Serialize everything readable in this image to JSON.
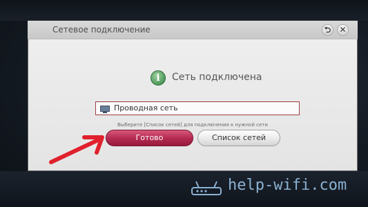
{
  "dialog": {
    "title": "Сетевое подключение",
    "back_icon": "back-arrow-icon",
    "close_icon": "close-icon",
    "back_glyph": "⮌",
    "close_glyph": "✕"
  },
  "status": {
    "icon": "info-icon",
    "icon_glyph": "i",
    "text": "Сеть подключена"
  },
  "network": {
    "icon": "network-icon",
    "label": "Проводная сеть"
  },
  "hint": "Выберите [Список сетей] для подключения к нужной сети",
  "buttons": {
    "done": "Готово",
    "network_list": "Список сетей"
  },
  "watermark": {
    "icon": "router-icon",
    "text": "help-wifi.com"
  },
  "colors": {
    "accent": "#b3284f",
    "arrow": "#e0202c",
    "watermark": "#8bb2d4"
  }
}
